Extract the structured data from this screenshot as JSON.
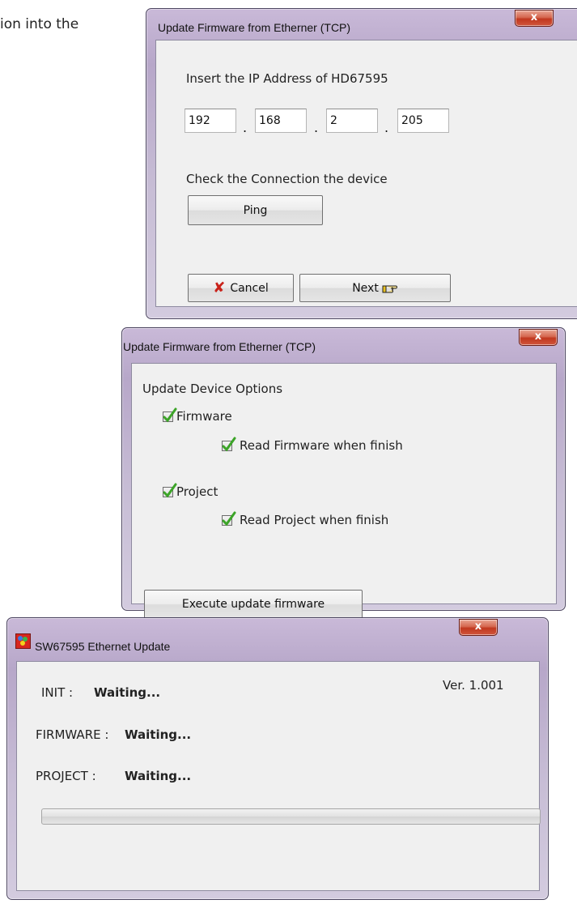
{
  "doc_text": "ion into the",
  "window1": {
    "title": "Update Firmware from Etherner (TCP)",
    "close_label": "x",
    "instruction": "Insert the IP Address of HD67595",
    "ip": [
      "192",
      "168",
      "2",
      "205"
    ],
    "ip_separator": ".",
    "check_label": "Check the Connection the device",
    "ping_label": "Ping",
    "cancel_label": "Cancel",
    "next_label": "Next"
  },
  "window2": {
    "title": "Update Firmware from Etherner (TCP)",
    "close_label": "x",
    "section_label": "Update Device Options",
    "options": [
      {
        "label": "Firmware",
        "checked": true
      },
      {
        "label": "Read Firmware when finish",
        "checked": true
      },
      {
        "label": "Project",
        "checked": true
      },
      {
        "label": "Read Project when finish",
        "checked": true
      }
    ],
    "execute_label": "Execute update firmware"
  },
  "window3": {
    "title": "SW67595 Ethernet Update",
    "close_label": "x",
    "version": "Ver. 1.001",
    "init_label": "INIT :",
    "init_status": "Waiting...",
    "firmware_label": "FIRMWARE :",
    "firmware_status": "Waiting...",
    "project_label": "PROJECT :",
    "project_status": "Waiting...",
    "progress": 0
  },
  "colors": {
    "check": "#3ca428",
    "cancel_x": "#c9221a",
    "close_button": "#c1381f"
  },
  "icons": {
    "app": "app-logo-icon",
    "cancel": "x-mark-icon",
    "next": "pointing-hand-icon",
    "check": "checkmark-icon"
  }
}
